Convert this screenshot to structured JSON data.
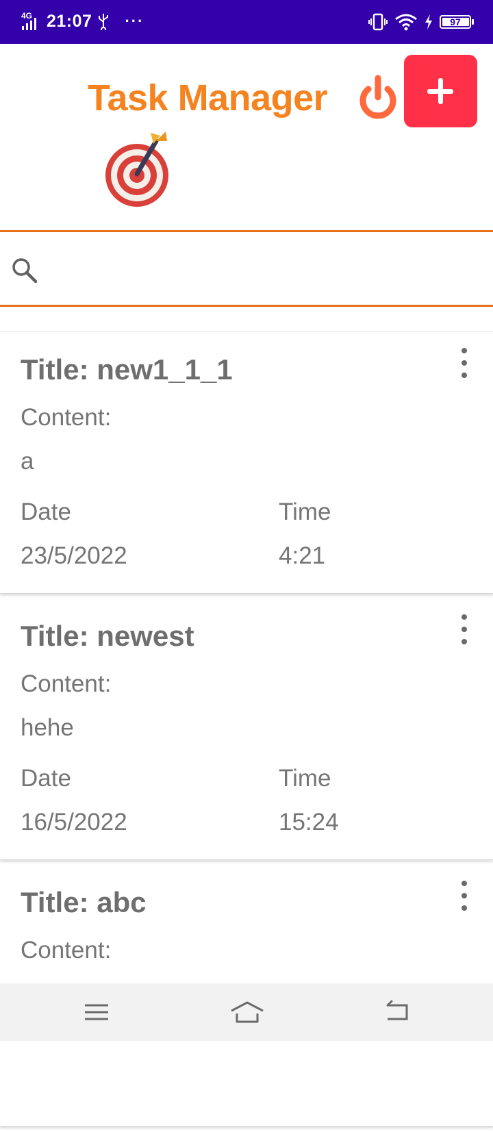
{
  "status_bar": {
    "network": "4G",
    "time": "21:07",
    "more": "···",
    "battery": "97"
  },
  "header": {
    "title": "Task Manager",
    "power_icon": "power-icon",
    "add_icon": "plus-icon",
    "decor_icon": "target-dart-icon",
    "title_color": "#f5831f",
    "add_color": "#ff3048"
  },
  "search": {
    "value": "",
    "icon": "search-icon"
  },
  "tasks": [
    {
      "title": "Title: new1_1_1",
      "content_label": "Content:",
      "content": "a",
      "date_label": "Date",
      "date": "23/5/2022",
      "time_label": "Time",
      "time": "4:21"
    },
    {
      "title": "Title: newest",
      "content_label": "Content:",
      "content": "hehe",
      "date_label": "Date",
      "date": "16/5/2022",
      "time_label": "Time",
      "time": "15:24"
    },
    {
      "title": "Title: abc",
      "content_label": "Content:"
    }
  ],
  "nav": {
    "menu_icon": "menu-icon",
    "home_icon": "home-icon",
    "back_icon": "back-icon"
  }
}
